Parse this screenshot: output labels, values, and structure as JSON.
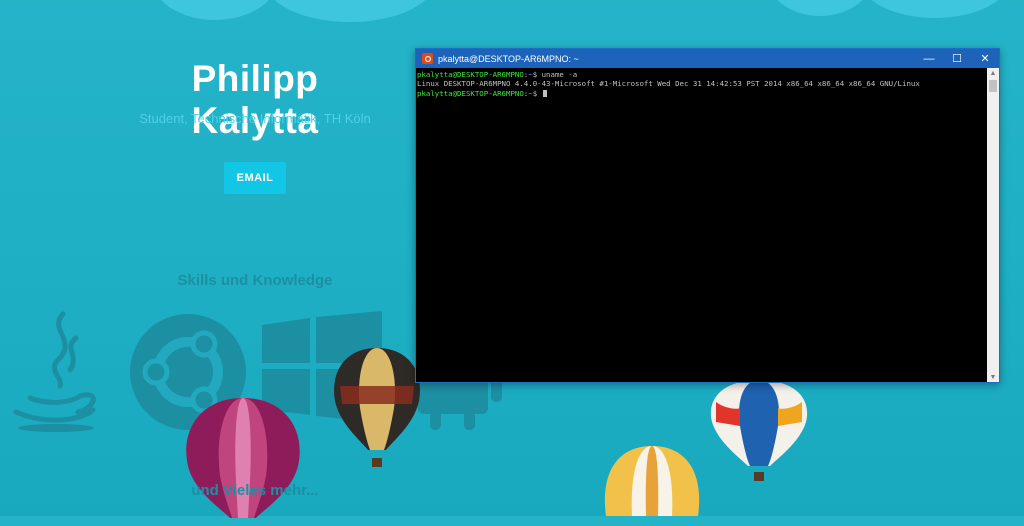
{
  "hero": {
    "name": "Philipp Kalytta",
    "subtitle": "Student, Technische Informatik, TH Köln",
    "email_label": "EMAIL"
  },
  "skills": {
    "title": "Skills und Knowledge",
    "icons": [
      "java-icon",
      "ubuntu-icon",
      "windows-icon",
      "android-icon"
    ],
    "more": "und Vieles mehr..."
  },
  "terminal": {
    "title": "pkalytta@DESKTOP-AR6MPNO: ~",
    "controls": {
      "minimize": "—",
      "maximize": "☐",
      "close": "✕"
    },
    "lines": [
      {
        "prompt": "pkalytta@DESKTOP-AR6MPNO",
        "path": "~",
        "command": "uname -a"
      },
      {
        "output": "Linux DESKTOP-AR6MPNO 4.4.0-43-Microsoft #1-Microsoft Wed Dec 31 14:42:53 PST 2014 x86_64 x86_64 x86_64 GNU/Linux"
      },
      {
        "prompt": "pkalytta@DESKTOP-AR6MPNO",
        "path": "~",
        "command": ""
      }
    ],
    "scroll_up": "▲",
    "scroll_down": "▼"
  },
  "colors": {
    "background": "#1fb0c6",
    "accent": "#12c7e6",
    "terminal_titlebar": "#1c63b9",
    "prompt": "#3ee83e"
  }
}
